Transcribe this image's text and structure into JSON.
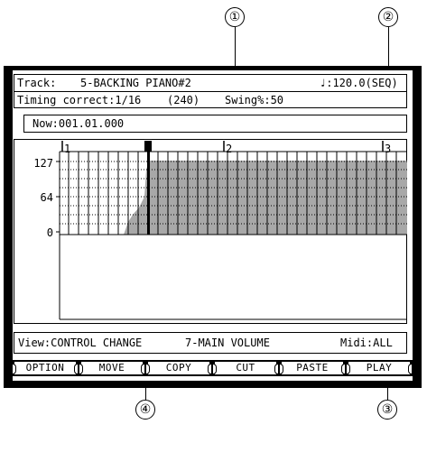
{
  "callouts": {
    "c1": "①",
    "c2": "②",
    "c3": "③",
    "c4": "④"
  },
  "header": {
    "track_label": "Track:",
    "track_value": "5-BACKING PIANO#2",
    "tempo": "♩:120.0(SEQ)",
    "timing_label": "Timing correct:1/16",
    "timing_ticks": "(240)",
    "swing": "Swing%:50"
  },
  "now": "Now:001.01.000",
  "grid": {
    "y_labels": [
      "127",
      "64",
      "0"
    ],
    "bar_labels": [
      "1",
      "2",
      "3"
    ],
    "fill_color": "#a8a8a8"
  },
  "footer": {
    "view": "View:CONTROL CHANGE",
    "controller": "7-MAIN VOLUME",
    "midi": "Midi:ALL"
  },
  "softkeys": [
    "OPTION",
    "MOVE",
    "COPY",
    "CUT",
    "PASTE",
    "PLAY"
  ]
}
